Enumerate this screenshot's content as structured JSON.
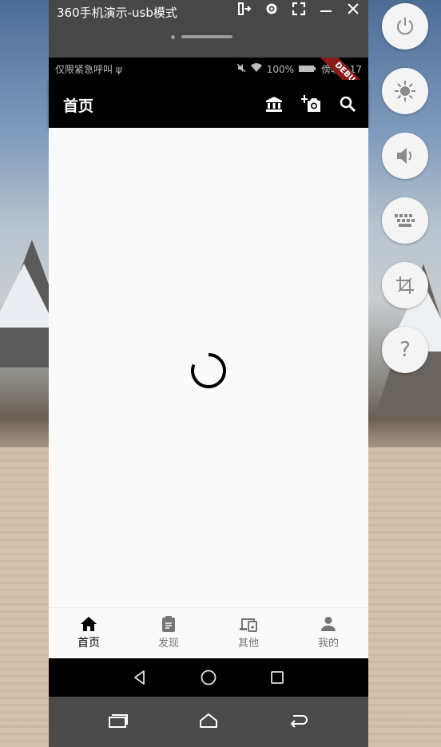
{
  "window": {
    "title": "360手机演示-usb模式",
    "controls": [
      "dock-icon",
      "gear-icon",
      "expand-icon",
      "minimize-icon",
      "close-icon"
    ]
  },
  "statusbar": {
    "left_text": "仅限紧急呼叫 ψ",
    "battery": "100%",
    "time_prefix": "傍晚",
    "time": "6:17",
    "debug_label": "DEBUG"
  },
  "appbar": {
    "title": "首页",
    "actions": [
      "bank-icon",
      "add-photo-icon",
      "search-icon"
    ]
  },
  "content": {
    "state": "loading"
  },
  "bottom_nav": {
    "items": [
      {
        "label": "首页",
        "icon": "home-icon",
        "active": true
      },
      {
        "label": "发现",
        "icon": "clipboard-icon",
        "active": false
      },
      {
        "label": "其他",
        "icon": "devices-icon",
        "active": false
      },
      {
        "label": "我的",
        "icon": "person-icon",
        "active": false
      }
    ]
  },
  "side_tools": [
    "power-icon",
    "brightness-icon",
    "volume-icon",
    "keyboard-icon",
    "crop-icon",
    "help-icon"
  ],
  "help_glyph": "?",
  "colors": {
    "appbar": "#000000",
    "content_bg": "#fafafa",
    "debug_ribbon": "#8b1a1a"
  }
}
